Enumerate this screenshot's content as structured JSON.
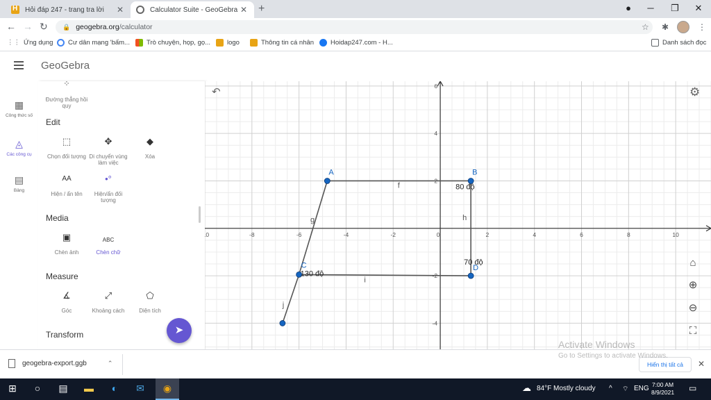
{
  "browser": {
    "tabs": [
      {
        "title": "Hỏi đáp 247 - trang tra lời",
        "active": false
      },
      {
        "title": "Calculator Suite - GeoGebra",
        "active": true
      }
    ],
    "url_host": "geogebra.org",
    "url_path": "/calculator",
    "bookmarks": [
      {
        "label": "Ứng dụng",
        "icon": "apps-grid-icon",
        "color": "#5f6368"
      },
      {
        "label": "Cư dân mạng 'bấm...",
        "icon": "google-icon",
        "color": "#4285f4"
      },
      {
        "label": "Trò chuyện, họp, gọ...",
        "icon": "microsoft-icon",
        "color": "#f25022"
      },
      {
        "label": "logo",
        "icon": "hoidap-icon",
        "color": "#e8a415"
      },
      {
        "label": "Thông tin cá nhân",
        "icon": "hoidap-icon",
        "color": "#e8a415"
      },
      {
        "label": "Hoidap247.com - H...",
        "icon": "facebook-icon",
        "color": "#1877f2"
      },
      {
        "label": "Danh sách đọc",
        "icon": "reading-list-icon",
        "color": "#5f6368"
      }
    ]
  },
  "app": {
    "name": "GeoGebra",
    "accent": "#6557d2",
    "rail": [
      {
        "label": "Công thức số",
        "icon": "calculator-icon",
        "active": false
      },
      {
        "label": "Các công cụ",
        "icon": "tools-icon",
        "active": true
      },
      {
        "label": "Bảng",
        "icon": "table-icon",
        "active": false
      }
    ],
    "tools": {
      "top_partial_label": "Đường thẳng hồi quy",
      "sections": [
        {
          "title": "Edit",
          "items": [
            {
              "label": "Chọn đối tượng",
              "icon": "select-icon"
            },
            {
              "label": "Di chuyển vùng làm việc",
              "icon": "move-graphics-icon"
            },
            {
              "label": "Xóa",
              "icon": "eraser-icon"
            },
            {
              "label": "Hiện / ẩn tên",
              "icon": "show-hide-label-icon"
            },
            {
              "label": "Hiện/ẩn đối tượng",
              "icon": "show-hide-object-icon"
            }
          ]
        },
        {
          "title": "Media",
          "items": [
            {
              "label": "Chèn ảnh",
              "icon": "image-icon"
            },
            {
              "label": "Chèn chữ",
              "icon": "text-icon",
              "highlight": true
            }
          ]
        },
        {
          "title": "Measure",
          "items": [
            {
              "label": "Góc",
              "icon": "angle-icon"
            },
            {
              "label": "Khoảng cách",
              "icon": "distance-icon"
            },
            {
              "label": "Diện tích",
              "icon": "area-icon"
            }
          ]
        },
        {
          "title": "Transform",
          "items": []
        }
      ]
    }
  },
  "graph": {
    "x_range": [
      -10,
      11.5
    ],
    "y_range": [
      -5.1,
      6.2
    ],
    "x_ticks": [
      -10,
      -8,
      -6,
      -4,
      -2,
      0,
      2,
      4,
      6,
      8,
      10
    ],
    "y_ticks": [
      -4,
      -2,
      2,
      4,
      6
    ],
    "grid": true,
    "point_color": "#1565c0",
    "line_color": "#555555",
    "points": [
      {
        "name": "A",
        "x": -4.8,
        "y": 2.0
      },
      {
        "name": "B",
        "x": 1.3,
        "y": 2.0
      },
      {
        "name": "C",
        "x": -6.0,
        "y": -1.95
      },
      {
        "name": "D",
        "x": 1.3,
        "y": -2.0
      },
      {
        "name": "",
        "x": -6.7,
        "y": -4.0
      }
    ],
    "segments": [
      {
        "name": "f",
        "from": 0,
        "to": 1
      },
      {
        "name": "h",
        "from": 1,
        "to": 3
      },
      {
        "name": "i",
        "from": 2,
        "to": 3
      },
      {
        "name": "g",
        "from": 0,
        "to": 2
      },
      {
        "name": "j",
        "from": 2,
        "to": 4
      }
    ],
    "texts": [
      "80 độ",
      "70 độ",
      "130 độ"
    ]
  },
  "download": {
    "file": "geogebra-export.ggb",
    "show_all": "Hiển thị tất cả"
  },
  "watermark": {
    "line1": "Activate Windows",
    "line2": "Go to Settings to activate Windows."
  },
  "taskbar": {
    "weather": "84°F  Mostly cloudy",
    "lang": "ENG",
    "time": "7:00 AM",
    "date": "8/9/2021"
  }
}
